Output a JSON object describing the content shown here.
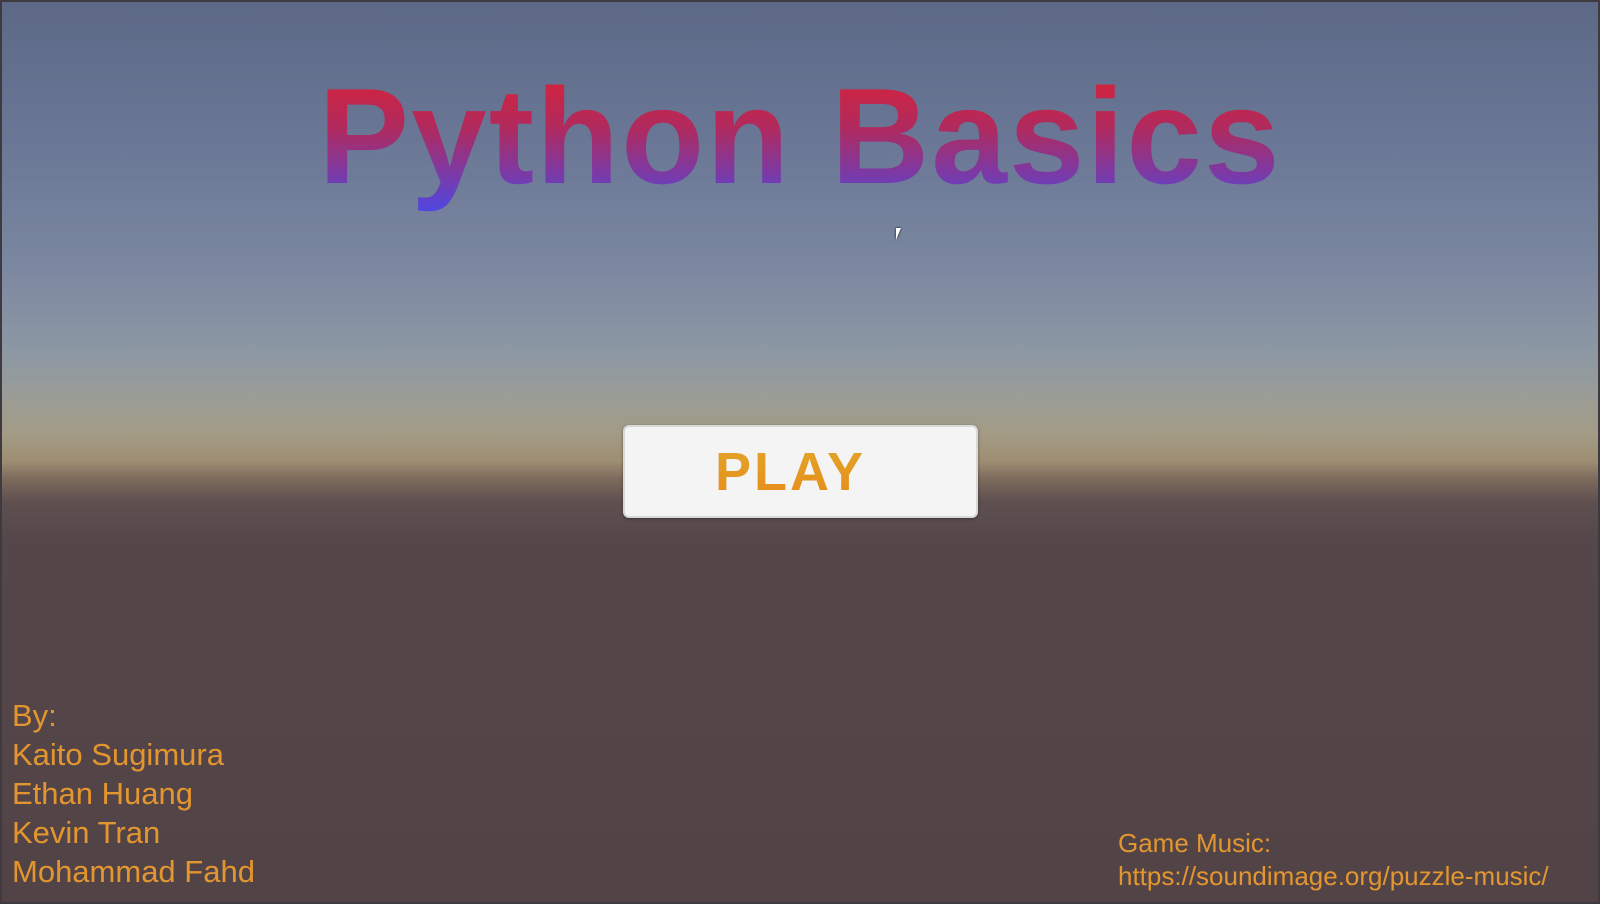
{
  "game": {
    "title": "Python Basics",
    "play_label": "PLAY"
  },
  "credits": {
    "heading": "By:",
    "authors": [
      "Kaito Sugimura",
      "Ethan Huang",
      "Kevin Tran",
      "Mohammad Fahd"
    ]
  },
  "music": {
    "heading": "Game Music:",
    "url": "https://soundimage.org/puzzle-music/"
  },
  "colors": {
    "title_top": "#e3202e",
    "title_bottom": "#4a48e8",
    "accent_text": "#e3962f",
    "button_bg": "#f4f4f4"
  }
}
